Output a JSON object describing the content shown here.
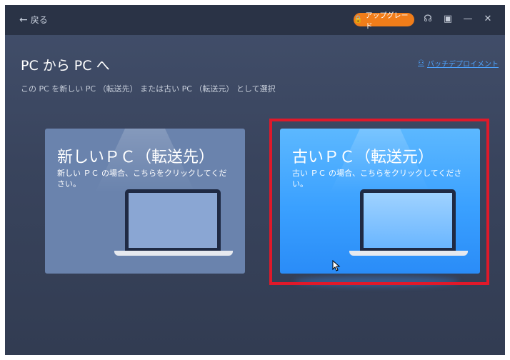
{
  "titlebar": {
    "back_label": "戻る",
    "upgrade_label": "アップグレード",
    "icons": [
      "headset-icon",
      "download-icon",
      "minimize-icon",
      "close-icon"
    ]
  },
  "main": {
    "title": "PC から PC へ",
    "subtitle": "この PC を新しい PC （転送先） または古い PC （転送元） として選択",
    "batch_link": "バッチデプロイメント"
  },
  "cards": {
    "new": {
      "title": "新しいＰＣ（転送先）",
      "desc": "新しい ＰＣ の場合、こちらをクリックしてください。"
    },
    "old": {
      "title": "古いＰＣ（転送元）",
      "desc": "古い ＰＣ の場合、こちらをクリックしてください。",
      "selected": true
    }
  },
  "colors": {
    "accent": "#f07d1a",
    "link": "#4da3ff",
    "selected_card": "#3aa0ff",
    "highlight_frame": "#e0192a"
  }
}
